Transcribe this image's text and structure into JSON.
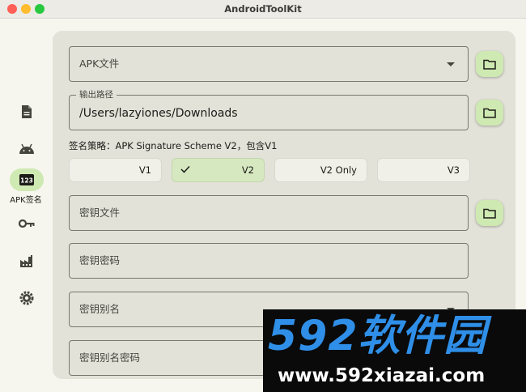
{
  "window": {
    "title": "AndroidToolKit"
  },
  "rail": {
    "items": [
      {
        "name": "document",
        "icon": "document-icon"
      },
      {
        "name": "android",
        "icon": "android-icon"
      },
      {
        "name": "apk-sign",
        "icon": "numbers-123-icon",
        "label": "APK签名",
        "active": true
      },
      {
        "name": "key",
        "icon": "key-icon"
      },
      {
        "name": "factory",
        "icon": "factory-icon"
      },
      {
        "name": "settings",
        "icon": "gear-icon"
      }
    ]
  },
  "form": {
    "apk_file_placeholder": "APK文件",
    "output_path": {
      "label": "输出路径",
      "value": "/Users/lazyiones/Downloads"
    },
    "strategy": "签名策略：APK Signature Scheme V2，包含V1",
    "segments": [
      {
        "label": "V1",
        "selected": false
      },
      {
        "label": "V2",
        "selected": true
      },
      {
        "label": "V2 Only",
        "selected": false
      },
      {
        "label": "V3",
        "selected": false
      }
    ],
    "keystore_file_placeholder": "密钥文件",
    "keystore_password_placeholder": "密钥密码",
    "key_alias_placeholder": "密钥别名",
    "key_alias_password_placeholder": "密钥别名密码"
  },
  "watermark": {
    "brand": "592软件园",
    "url": "www.592xiazai.com"
  },
  "colors": {
    "accent": "#cfe9b2",
    "surface": "#e2e2d9",
    "background": "#f6f5ee",
    "watermark_blue": "#2f8fe8"
  }
}
